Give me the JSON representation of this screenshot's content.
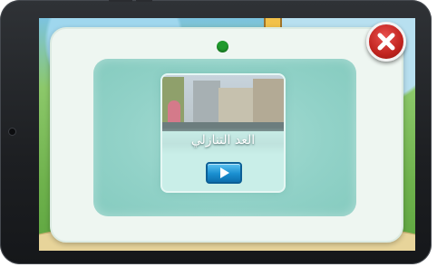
{
  "app": {
    "dialog": {
      "close_icon": "close-icon",
      "status_indicator_color": "#1f9a2c"
    },
    "lesson_card": {
      "title": "العد التنازلي",
      "thumbnail_icon": "street-scene-thumbnail",
      "play_icon": "play-icon"
    }
  },
  "colors": {
    "dialog_bg": "#eef6f1",
    "panel_bg": "#92d2c8",
    "close_red": "#c1241f",
    "play_blue": "#1a8fd0"
  }
}
